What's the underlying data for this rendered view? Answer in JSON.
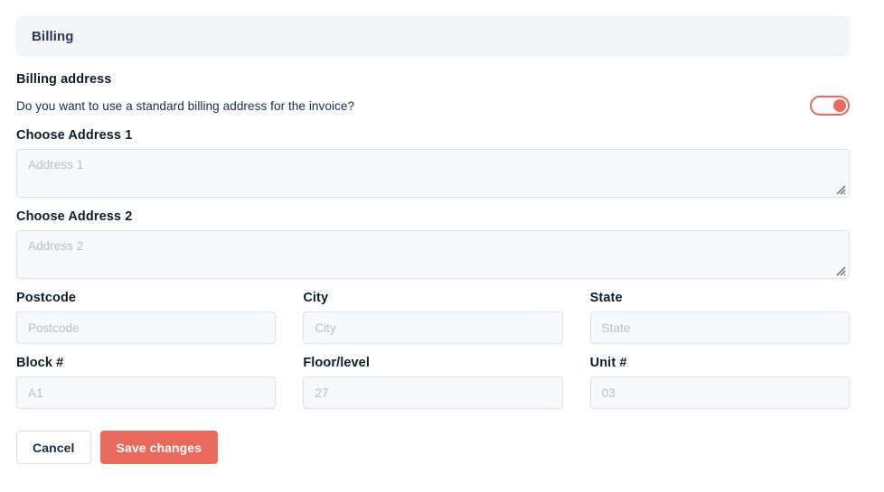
{
  "section": {
    "title": "Billing"
  },
  "billing_address": {
    "heading": "Billing address",
    "prompt": "Do you want to use a standard billing address for the invoice?",
    "toggle": {
      "name": "standard-billing-address-toggle",
      "state": "on",
      "accent_color": "#e9695c"
    }
  },
  "fields": {
    "address1": {
      "label": "Choose Address 1",
      "placeholder": "Address 1",
      "value": ""
    },
    "address2": {
      "label": "Choose Address 2",
      "placeholder": "Address 2",
      "value": ""
    },
    "postcode": {
      "label": "Postcode",
      "placeholder": "Postcode",
      "value": ""
    },
    "city": {
      "label": "City",
      "placeholder": "City",
      "value": ""
    },
    "state": {
      "label": "State",
      "placeholder": "State",
      "value": ""
    },
    "block": {
      "label": "Block #",
      "placeholder": "A1",
      "value": ""
    },
    "floor": {
      "label": "Floor/level",
      "placeholder": "27",
      "value": ""
    },
    "unit": {
      "label": "Unit #",
      "placeholder": "03",
      "value": ""
    }
  },
  "actions": {
    "cancel_label": "Cancel",
    "save_label": "Save changes"
  },
  "icons": {
    "resize_grip": "resize-grip-icon"
  },
  "colors": {
    "accent": "#e9695c",
    "header_bg": "#f4f5f7",
    "input_bg": "#f8f9fb",
    "input_border": "#dfe1e6",
    "text": "#172b4d",
    "placeholder": "#b9bec7"
  }
}
